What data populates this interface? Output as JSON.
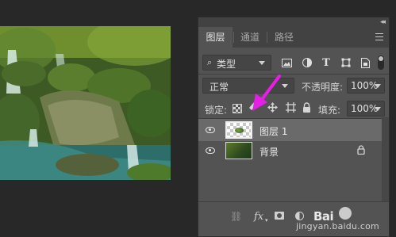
{
  "panel": {
    "tabs": [
      {
        "label": "图层",
        "active": true
      },
      {
        "label": "通道",
        "active": false
      },
      {
        "label": "路径",
        "active": false
      }
    ],
    "collapse_glyph": "◂◂",
    "filter": {
      "kind_label": "类型",
      "search_glyph": "⌕",
      "icons": [
        "pixel-filter-icon",
        "adjustment-filter-icon",
        "type-filter-icon",
        "shape-filter-icon",
        "smart-object-filter-icon"
      ],
      "type_glyph": "T"
    },
    "blend": {
      "mode": "正常",
      "opacity_label": "不透明度:",
      "opacity_value": "100%"
    },
    "lock": {
      "label": "锁定:",
      "fill_label": "填充:",
      "fill_value": "100%"
    },
    "layers": [
      {
        "name": "图层 1",
        "visible": true,
        "selected": true
      },
      {
        "name": "背景",
        "visible": true,
        "selected": false,
        "locked": true
      }
    ],
    "bottom_toolbar": {
      "link_glyph": "⛓",
      "fx_label": "fx",
      "fx_dropdown_glyph": "▾"
    }
  },
  "watermark": {
    "logo_text": "Bai",
    "url": "jingyan.baidu.com"
  },
  "colors": {
    "panel_bg": "#535353",
    "selected_layer_bg": "#6a6a6a",
    "annotation_arrow": "#e61ee6"
  }
}
